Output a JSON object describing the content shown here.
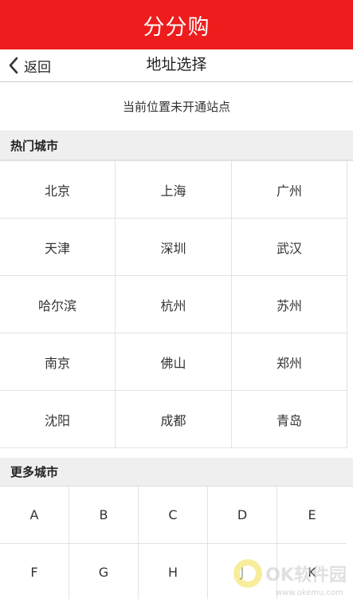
{
  "header": {
    "title": "分分购"
  },
  "nav": {
    "back_label": "返回",
    "title": "地址选择"
  },
  "location_notice": "当前位置未开通站点",
  "hot_cities": {
    "title": "热门城市",
    "cities": [
      "北京",
      "上海",
      "广州",
      "天津",
      "深圳",
      "武汉",
      "哈尔滨",
      "杭州",
      "苏州",
      "南京",
      "佛山",
      "郑州",
      "沈阳",
      "成都",
      "青岛"
    ]
  },
  "more_cities": {
    "title": "更多城市",
    "letters": [
      "A",
      "B",
      "C",
      "D",
      "E",
      "F",
      "G",
      "H",
      "J",
      "K"
    ]
  },
  "watermark": {
    "text": "OK软件园",
    "sub": "www.okemu.com"
  },
  "colors": {
    "header_bg": "#ee1c1c",
    "section_bg": "#efefef"
  }
}
